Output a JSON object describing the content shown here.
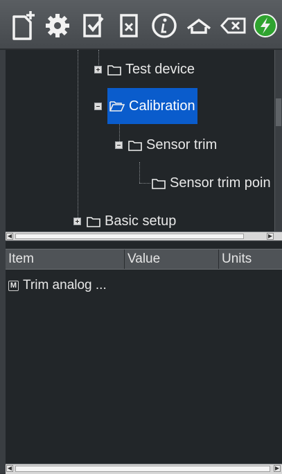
{
  "toolbar": {
    "buttons": [
      {
        "name": "new-document"
      },
      {
        "name": "settings"
      },
      {
        "name": "check-document"
      },
      {
        "name": "delete-document"
      },
      {
        "name": "info"
      },
      {
        "name": "home"
      },
      {
        "name": "backspace"
      },
      {
        "name": "connect"
      }
    ],
    "accent_color": "#2fa32f"
  },
  "tree": {
    "nodes": [
      {
        "label": "Test device",
        "expanded": false
      },
      {
        "label": "Calibration",
        "expanded": true,
        "selected": true
      },
      {
        "label": "Sensor trim",
        "expanded": true
      },
      {
        "label": "Sensor trim poin"
      },
      {
        "label": "Basic setup",
        "expanded": false
      }
    ],
    "selection_color": "#0a5ccc"
  },
  "grid": {
    "columns": [
      "Item",
      "Value",
      "Units"
    ],
    "rows": [
      {
        "badge": "M",
        "item": "Trim analog ..."
      }
    ]
  }
}
